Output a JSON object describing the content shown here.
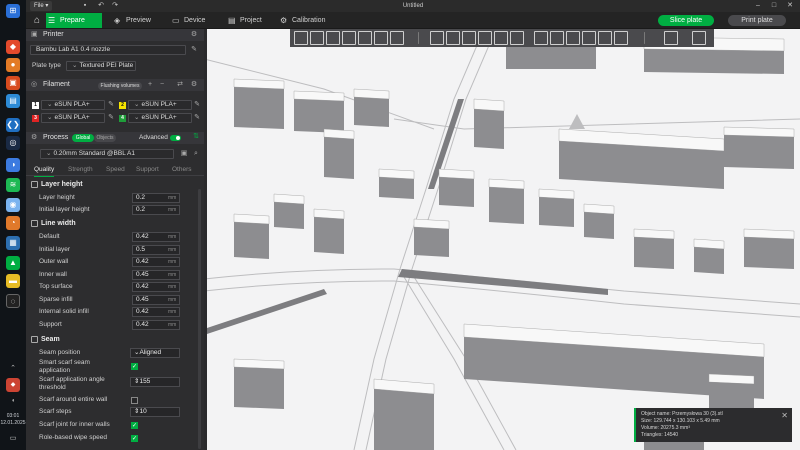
{
  "titlebar": {
    "file_menu": "File",
    "window_title": "Untitled"
  },
  "tabs": [
    {
      "label": "Prepare",
      "icon": "sliders-icon",
      "active": true
    },
    {
      "label": "Preview",
      "icon": "cube-icon",
      "active": false
    },
    {
      "label": "Device",
      "icon": "monitor-icon",
      "active": false
    },
    {
      "label": "Project",
      "icon": "document-icon",
      "active": false
    },
    {
      "label": "Calibration",
      "icon": "calibration-icon",
      "active": false
    }
  ],
  "actions": {
    "slice_plate": "Slice plate",
    "print_plate": "Print plate"
  },
  "colors": {
    "accent": "#00ae42",
    "panel": "#2d2d2f",
    "section_header": "#36363a",
    "viewport": "#f3f3f4"
  },
  "taskbar": {
    "time": "03:01",
    "date": "12.01.2025"
  },
  "printer": {
    "section_title": "Printer",
    "model": "Bambu Lab A1 0.4 nozzle",
    "plate_type_label": "Plate type",
    "plate_type": "Textured PEI Plate"
  },
  "filament": {
    "section_title": "Filament",
    "flushing_label": "Flushing volumes",
    "slots": [
      {
        "num": "1",
        "color": "#ffffff",
        "name": "eSUN PLA+"
      },
      {
        "num": "2",
        "color": "#f5e400",
        "name": "eSUN PLA+"
      },
      {
        "num": "3",
        "color": "#e02424",
        "name": "eSUN PLA+"
      },
      {
        "num": "4",
        "color": "#1f9d3a",
        "name": "eSUN PLA+"
      }
    ]
  },
  "process": {
    "section_title": "Process",
    "toggle_global": "Global",
    "toggle_objects": "Objects",
    "advanced_label": "Advanced",
    "preset": "0.20mm Standard @BBL A1",
    "subtabs": [
      "Quality",
      "Strength",
      "Speed",
      "Support",
      "Others"
    ]
  },
  "layer_height": {
    "title": "Layer height",
    "params": [
      {
        "label": "Layer height",
        "value": "0.2",
        "unit": "mm"
      },
      {
        "label": "Initial layer height",
        "value": "0.2",
        "unit": "mm"
      }
    ]
  },
  "line_width": {
    "title": "Line width",
    "params": [
      {
        "label": "Default",
        "value": "0.42",
        "unit": "mm"
      },
      {
        "label": "Initial layer",
        "value": "0.5",
        "unit": "mm"
      },
      {
        "label": "Outer wall",
        "value": "0.42",
        "unit": "mm"
      },
      {
        "label": "Inner wall",
        "value": "0.45",
        "unit": "mm"
      },
      {
        "label": "Top surface",
        "value": "0.42",
        "unit": "mm"
      },
      {
        "label": "Sparse infill",
        "value": "0.45",
        "unit": "mm"
      },
      {
        "label": "Internal solid infill",
        "value": "0.42",
        "unit": "mm"
      },
      {
        "label": "Support",
        "value": "0.42",
        "unit": "mm"
      }
    ]
  },
  "seam": {
    "title": "Seam",
    "seam_position_label": "Seam position",
    "seam_position": "Aligned",
    "smart_scarf_label": "Smart scarf seam application",
    "scarf_angle_label": "Scarf application angle threshold",
    "scarf_angle": "155",
    "scarf_around_label": "Scarf around entire wall",
    "scarf_steps_label": "Scarf steps",
    "scarf_steps": "10",
    "scarf_inner_label": "Scarf joint for inner walls",
    "role_wipe_label": "Role-based wipe speed"
  },
  "object_info": {
    "name": "Object name: Przemysłowa 30 (3).stl",
    "size": "Size: 129.744 x 130.103 x 5.49 mm",
    "volume": "Volume: 20275.3 mm³",
    "triangles": "Triangles: 14540"
  }
}
